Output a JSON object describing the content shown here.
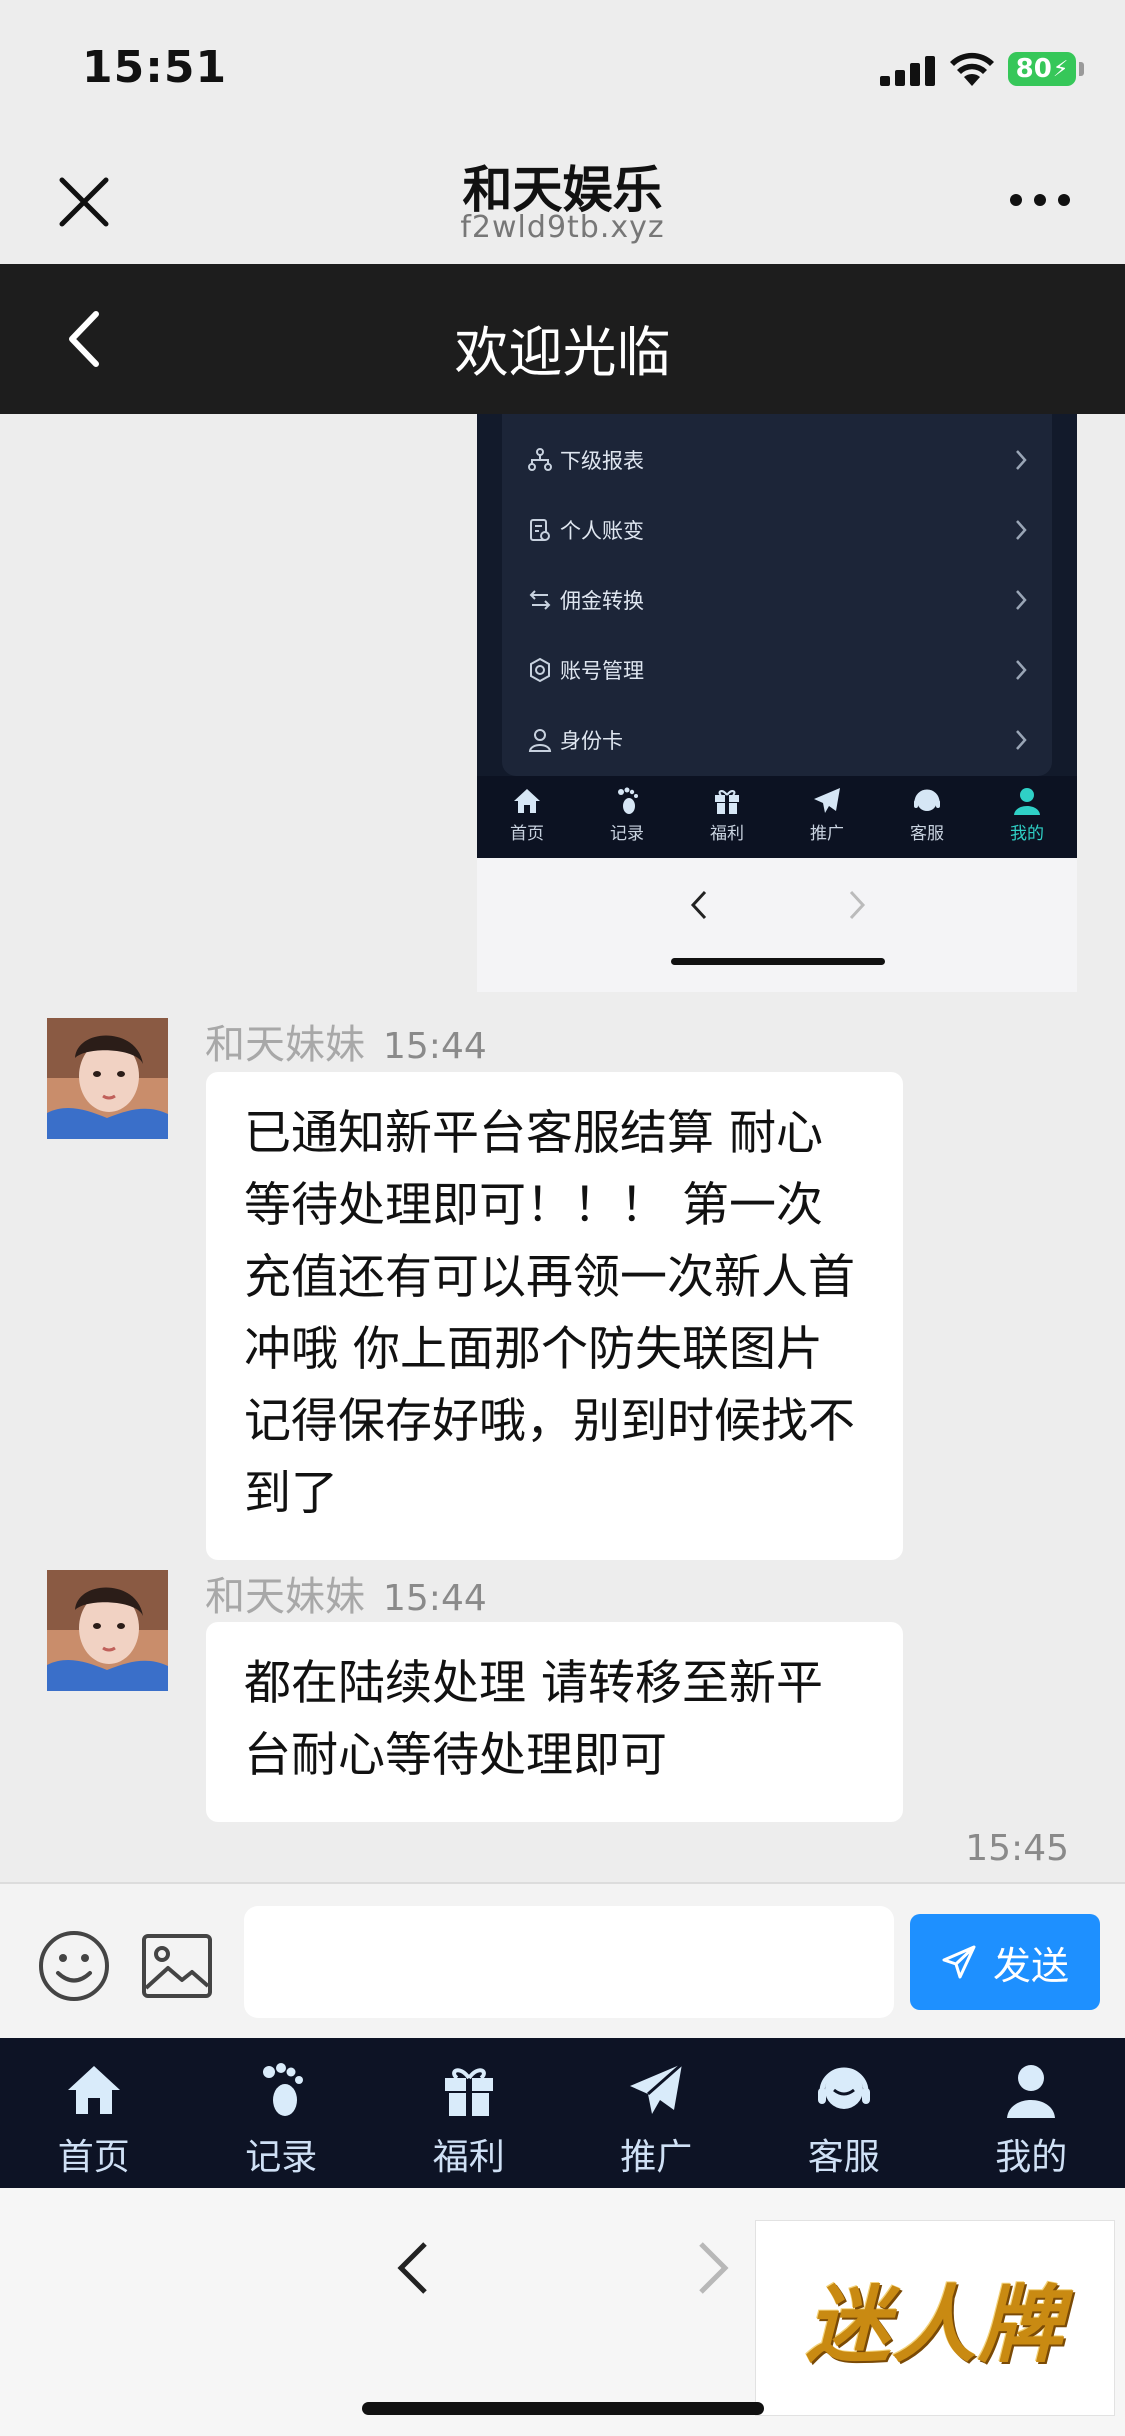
{
  "status_bar": {
    "time": "15:51",
    "battery": "80"
  },
  "mini_program": {
    "title": "和天娱乐",
    "url": "f2wld9tb.xyz"
  },
  "page": {
    "title": "欢迎光临"
  },
  "shared_screenshot": {
    "menu": [
      {
        "label": "下级报表",
        "icon": "org-tree-icon"
      },
      {
        "label": "个人账变",
        "icon": "ledger-icon"
      },
      {
        "label": "佣金转换",
        "icon": "swap-icon"
      },
      {
        "label": "账号管理",
        "icon": "settings-icon"
      },
      {
        "label": "身份卡",
        "icon": "user-card-icon"
      }
    ],
    "tabs": [
      {
        "label": "首页",
        "icon": "home-icon"
      },
      {
        "label": "记录",
        "icon": "footprint-icon"
      },
      {
        "label": "福利",
        "icon": "gift-icon"
      },
      {
        "label": "推广",
        "icon": "paper-plane-icon"
      },
      {
        "label": "客服",
        "icon": "headset-icon"
      },
      {
        "label": "我的",
        "icon": "user-icon",
        "active": true
      }
    ]
  },
  "messages": [
    {
      "sender": "和天妹妹",
      "time": "15:44",
      "text": "已通知新平台客服结算 耐心等待处理即可！！！ 第一次充值还有可以再领一次新人首冲哦 你上面那个防失联图片记得保存好哦，别到时候找不到了"
    },
    {
      "sender": "和天妹妹",
      "time": "15:44",
      "text": "都在陆续处理 请转移至新平台耐心等待处理即可"
    }
  ],
  "last_time": "15:45",
  "input": {
    "value": "",
    "send_label": "发送"
  },
  "tabbar": [
    {
      "label": "首页",
      "icon": "home-icon"
    },
    {
      "label": "记录",
      "icon": "footprint-icon"
    },
    {
      "label": "福利",
      "icon": "gift-icon"
    },
    {
      "label": "推广",
      "icon": "paper-plane-icon"
    },
    {
      "label": "客服",
      "icon": "headset-icon"
    },
    {
      "label": "我的",
      "icon": "user-icon"
    }
  ],
  "watermark": "迷人牌",
  "colors": {
    "accent": "#1e90ff",
    "tab_active": "#2fd0c6",
    "header_bg": "#1d1d1d",
    "tabbar_bg": "#0d1325"
  }
}
